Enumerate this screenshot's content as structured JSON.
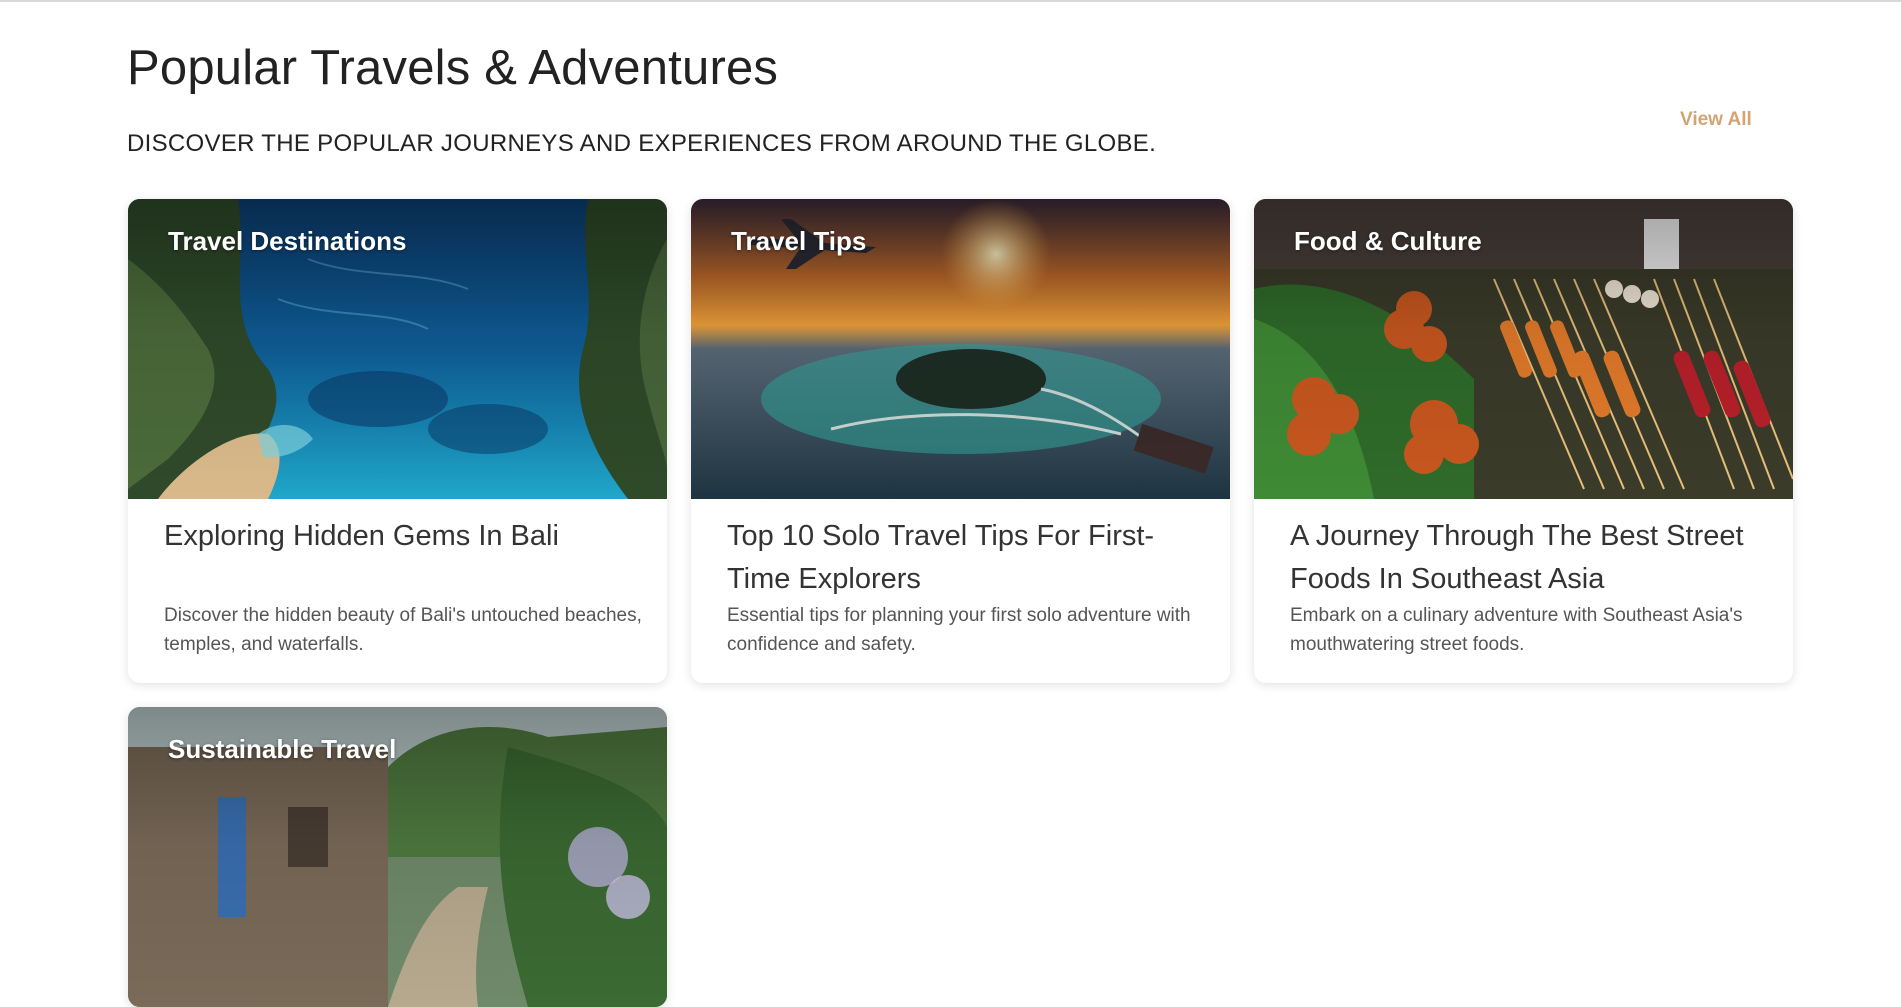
{
  "header": {
    "title": "Popular Travels & Adventures",
    "subtitle": "DISCOVER THE POPULAR JOURNEYS AND EXPERIENCES FROM AROUND THE GLOBE.",
    "view_all_label": "View All"
  },
  "colors": {
    "accent": "#d4a373",
    "text_dark": "#222222",
    "text_muted": "#555555"
  },
  "cards": [
    {
      "category": "Travel Destinations",
      "title": "Exploring Hidden Gems In Bali",
      "description": "Discover the hidden beauty of Bali's untouched beaches, temples, and waterfalls.",
      "image": "bali-cliff-beach-image"
    },
    {
      "category": "Travel Tips",
      "title": "Top 10 Solo Travel Tips For First-Time Explorers",
      "description": "Essential tips for planning your first solo adventure with confidence and safety.",
      "image": "sunset-island-airplane-image"
    },
    {
      "category": "Food & Culture",
      "title": "A Journey Through The Best Street Foods In Southeast Asia",
      "description": "Embark on a culinary adventure with Southeast Asia's mouthwatering street foods.",
      "image": "street-food-stall-image"
    },
    {
      "category": "Sustainable Travel",
      "title": "",
      "description": "",
      "image": "village-alley-greenery-image"
    }
  ]
}
